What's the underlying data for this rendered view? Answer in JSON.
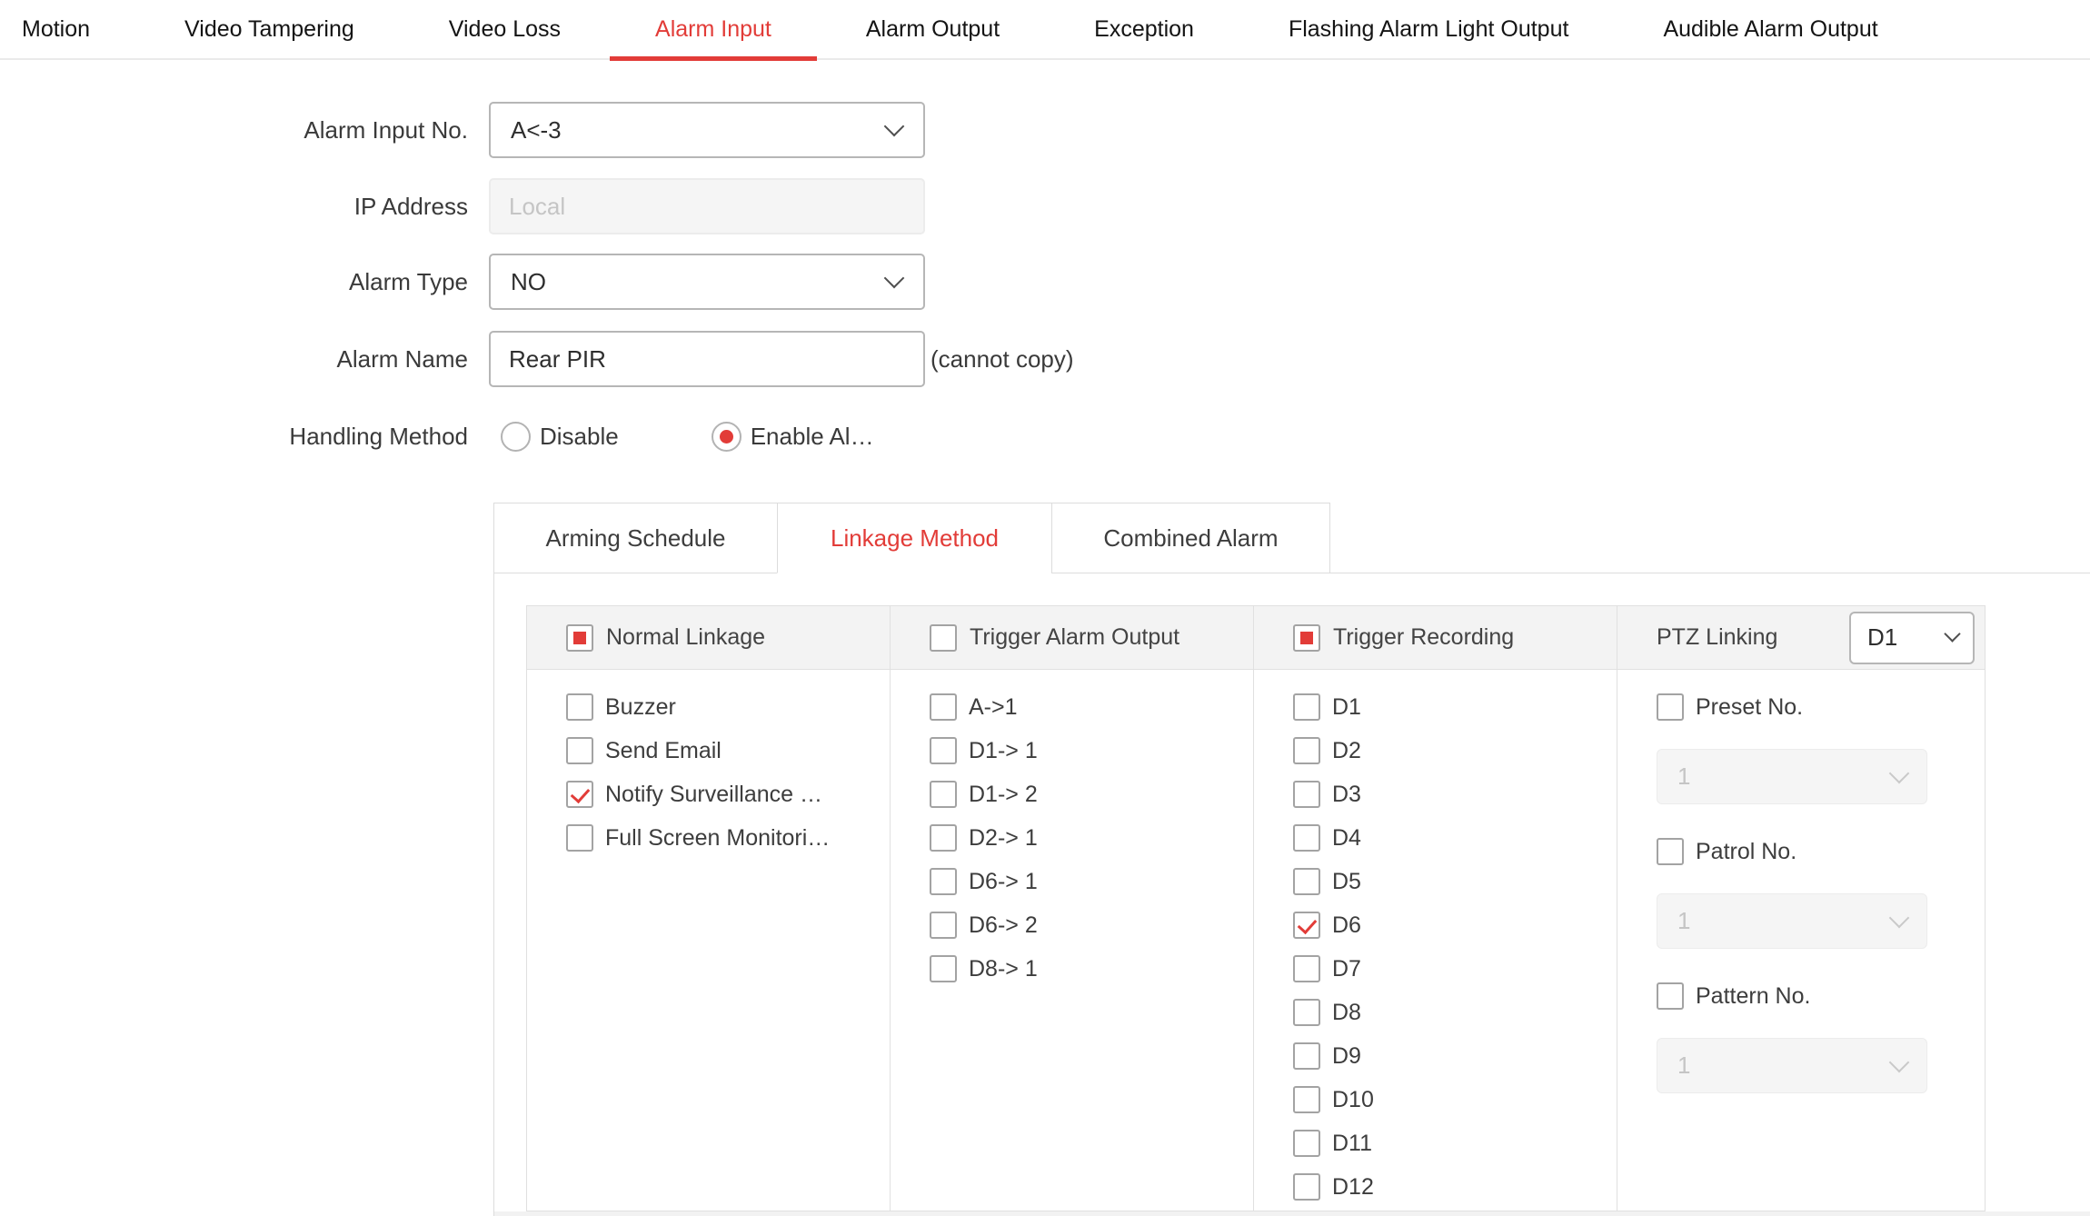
{
  "accent_color": "#e23c38",
  "top_tabs": {
    "items": [
      {
        "label": "Motion",
        "active": false
      },
      {
        "label": "Video Tampering",
        "active": false
      },
      {
        "label": "Video Loss",
        "active": false
      },
      {
        "label": "Alarm Input",
        "active": true
      },
      {
        "label": "Alarm Output",
        "active": false
      },
      {
        "label": "Exception",
        "active": false
      },
      {
        "label": "Flashing Alarm Light Output",
        "active": false
      },
      {
        "label": "Audible Alarm Output",
        "active": false
      }
    ]
  },
  "form": {
    "alarm_input_no": {
      "label": "Alarm Input No.",
      "value": "A<-3"
    },
    "ip_address": {
      "label": "IP Address",
      "value": "Local",
      "disabled": true
    },
    "alarm_type": {
      "label": "Alarm Type",
      "value": "NO"
    },
    "alarm_name": {
      "label": "Alarm Name",
      "value": "Rear PIR",
      "note": "(cannot copy)"
    },
    "handling_method": {
      "label": "Handling Method",
      "options": [
        {
          "label": "Disable",
          "selected": false
        },
        {
          "label": "Enable Al…",
          "selected": true
        }
      ]
    }
  },
  "sub_tabs": {
    "items": [
      {
        "label": "Arming Schedule",
        "active": false
      },
      {
        "label": "Linkage Method",
        "active": true
      },
      {
        "label": "Combined Alarm",
        "active": false
      }
    ]
  },
  "linkage": {
    "normal_linkage": {
      "header": "Normal Linkage",
      "indeterminate": true,
      "items": [
        {
          "label": "Buzzer",
          "checked": false
        },
        {
          "label": "Send Email",
          "checked": false
        },
        {
          "label": "Notify Surveillance …",
          "checked": true
        },
        {
          "label": "Full Screen Monitori…",
          "checked": false
        }
      ]
    },
    "trigger_alarm_output": {
      "header": "Trigger Alarm Output",
      "indeterminate": false,
      "items": [
        {
          "label": "A->1",
          "checked": false
        },
        {
          "label": "D1-> 1",
          "checked": false
        },
        {
          "label": "D1-> 2",
          "checked": false
        },
        {
          "label": "D2-> 1",
          "checked": false
        },
        {
          "label": "D6-> 1",
          "checked": false
        },
        {
          "label": "D6-> 2",
          "checked": false
        },
        {
          "label": "D8-> 1",
          "checked": false
        }
      ]
    },
    "trigger_recording": {
      "header": "Trigger Recording",
      "indeterminate": true,
      "items": [
        {
          "label": "D1",
          "checked": false
        },
        {
          "label": "D2",
          "checked": false
        },
        {
          "label": "D3",
          "checked": false
        },
        {
          "label": "D4",
          "checked": false
        },
        {
          "label": "D5",
          "checked": false
        },
        {
          "label": "D6",
          "checked": true
        },
        {
          "label": "D7",
          "checked": false
        },
        {
          "label": "D8",
          "checked": false
        },
        {
          "label": "D9",
          "checked": false
        },
        {
          "label": "D10",
          "checked": false
        },
        {
          "label": "D11",
          "checked": false
        },
        {
          "label": "D12",
          "checked": false
        }
      ]
    },
    "ptz": {
      "title": "PTZ Linking",
      "channel": "D1",
      "sections": [
        {
          "label": "Preset No.",
          "checked": false,
          "value": "1"
        },
        {
          "label": "Patrol No.",
          "checked": false,
          "value": "1"
        },
        {
          "label": "Pattern No.",
          "checked": false,
          "value": "1"
        }
      ]
    }
  }
}
